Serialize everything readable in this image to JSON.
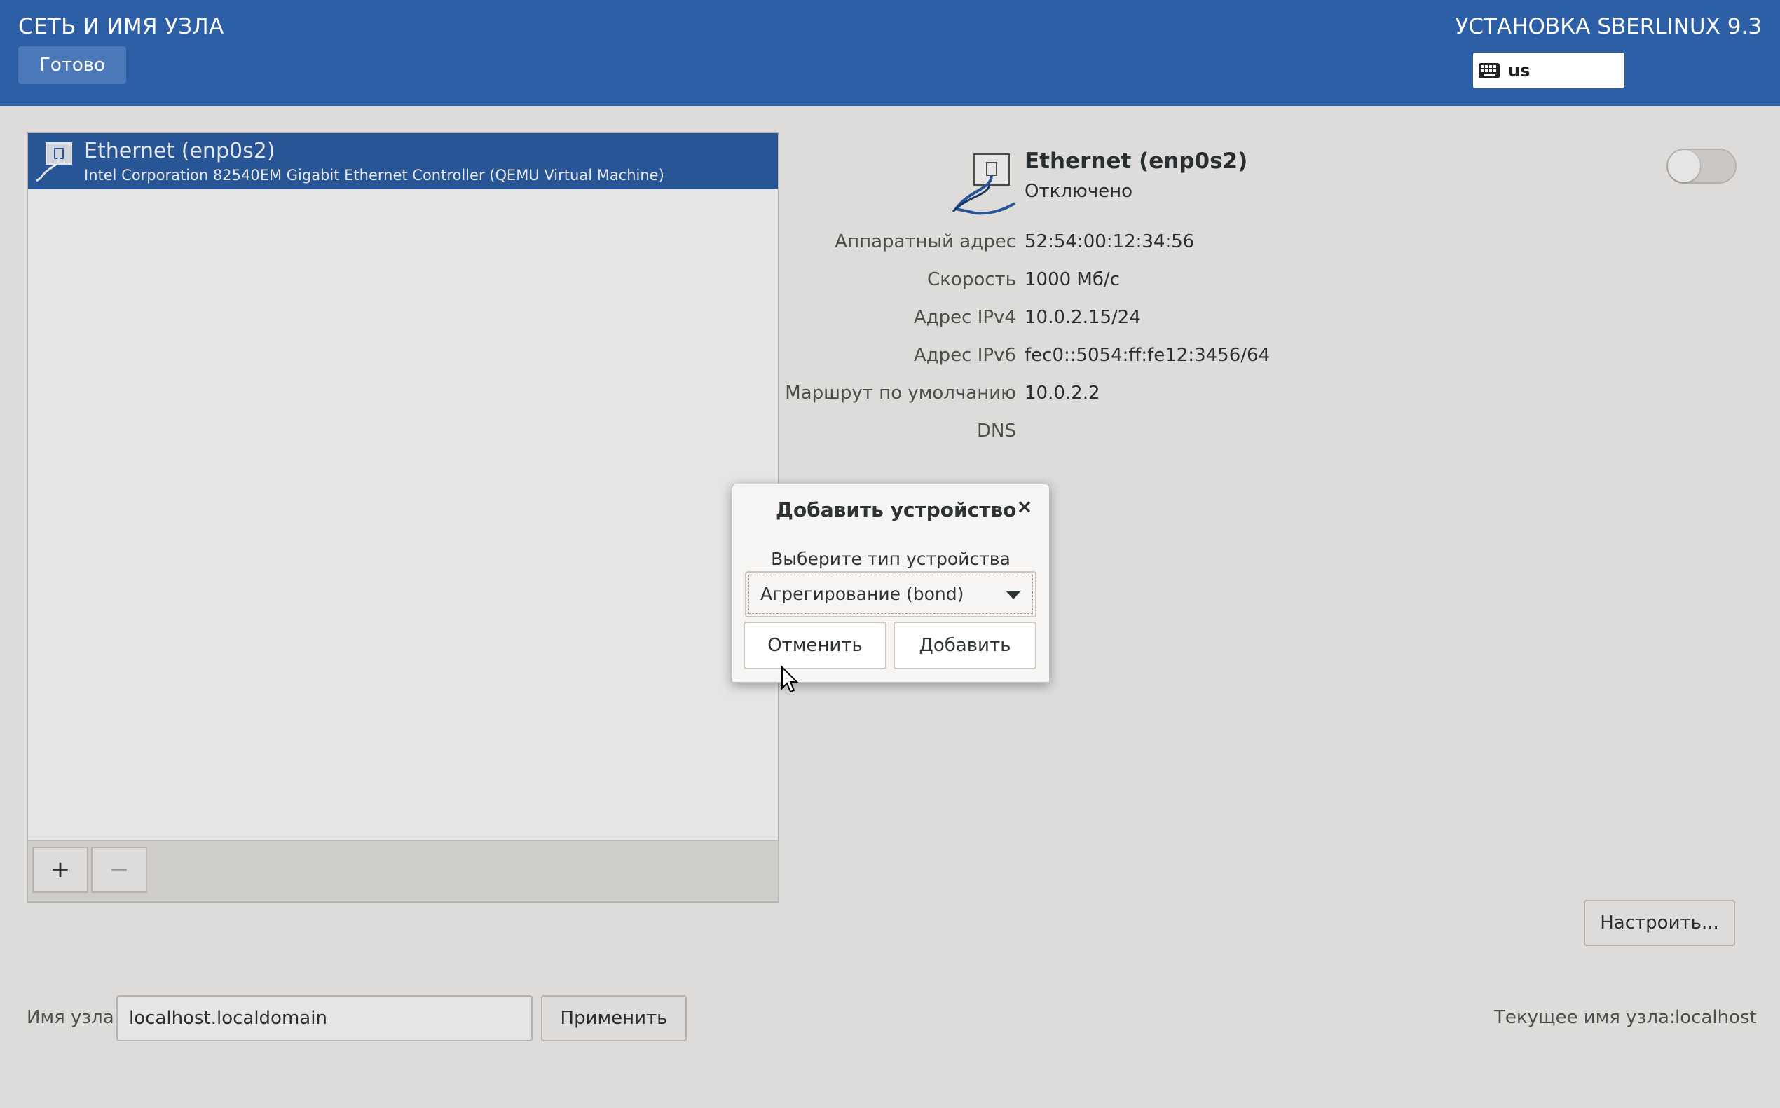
{
  "header": {
    "title": "СЕТЬ И ИМЯ УЗЛА",
    "done_label": "Готово",
    "installer_title": "УСТАНОВКА SBERLINUX 9.3",
    "keyboard_layout": "us"
  },
  "device_list": {
    "items": [
      {
        "name": "Ethernet (enp0s2)",
        "description": "Intel Corporation 82540EM Gigabit Ethernet Controller (QEMU Virtual Machine)",
        "selected": true
      }
    ],
    "add_label": "+",
    "remove_label": "−"
  },
  "details": {
    "title": "Ethernet (enp0s2)",
    "status": "Отключено",
    "toggle_on": false,
    "rows": [
      {
        "label": "Аппаратный адрес",
        "value": "52:54:00:12:34:56"
      },
      {
        "label": "Скорость",
        "value": "1000 Мб/с"
      },
      {
        "label": "Адрес IPv4",
        "value": "10.0.2.15/24"
      },
      {
        "label": "Адрес IPv6",
        "value": "fec0::5054:ff:fe12:3456/64"
      },
      {
        "label": "Маршрут по умолчанию",
        "value": "10.0.2.2"
      },
      {
        "label": "DNS",
        "value": ""
      }
    ],
    "configure_label": "Настроить..."
  },
  "hostname": {
    "label": "Имя узла:",
    "value": "localhost.localdomain",
    "apply_label": "Применить",
    "current_label": "Текущее имя узла:",
    "current_value": "localhost"
  },
  "dialog": {
    "title": "Добавить устройство",
    "close_label": "×",
    "prompt": "Выберите тип устройства",
    "selected_type": "Агрегирование (bond)",
    "cancel_label": "Отменить",
    "add_label": "Добавить"
  },
  "colors": {
    "header_bg": "#2c5fa6",
    "selection_bg": "#2c5fa6",
    "window_bg": "#f6f5f4"
  }
}
